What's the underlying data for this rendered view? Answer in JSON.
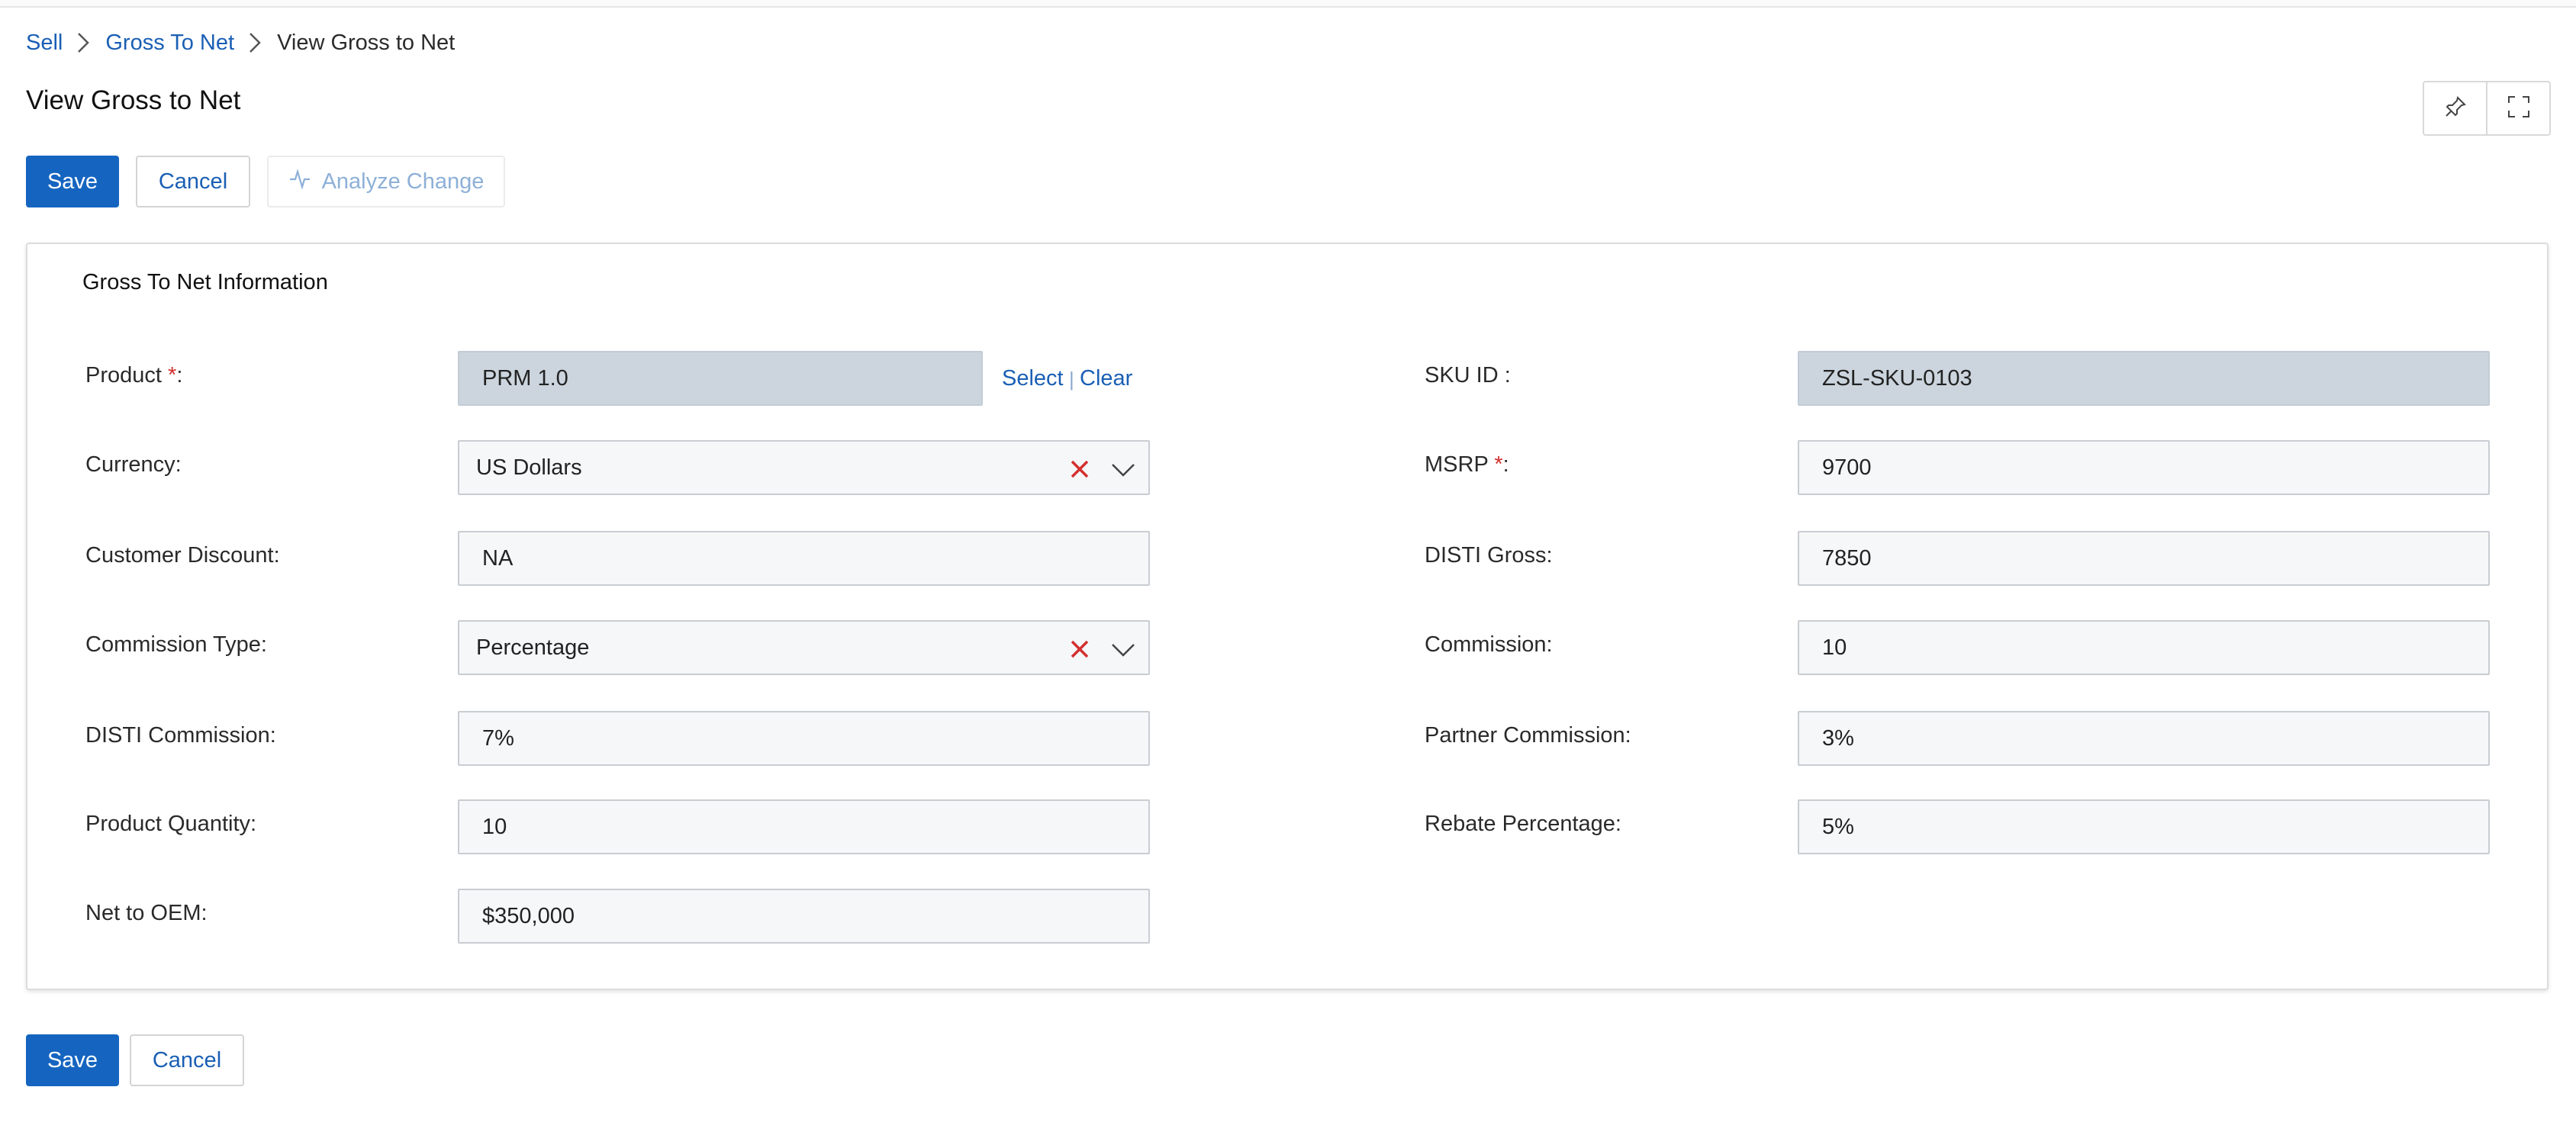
{
  "breadcrumb": {
    "items": [
      "Sell",
      "Gross To Net"
    ],
    "current": "View Gross to Net"
  },
  "page": {
    "title": "View Gross to Net"
  },
  "toolbar": {
    "save_label": "Save",
    "cancel_label": "Cancel",
    "analyze_label": "Analyze Change"
  },
  "section": {
    "title": "Gross To Net Information"
  },
  "left_fields": {
    "product": {
      "label": "Product",
      "required_mark": "*",
      "colon": ":",
      "value": "PRM 1.0",
      "select_label": "Select",
      "separator": "|",
      "clear_label": "Clear"
    },
    "currency": {
      "label": "Currency:",
      "value": "US Dollars"
    },
    "customer_discount": {
      "label": "Customer Discount:",
      "value": "NA"
    },
    "commission_type": {
      "label": "Commission Type:",
      "value": "Percentage"
    },
    "disti_commission": {
      "label": "DISTI Commission:",
      "value": "7%"
    },
    "product_quantity": {
      "label": "Product Quantity:",
      "value": "10"
    },
    "net_to_oem": {
      "label": "Net to OEM:",
      "value": "$350,000"
    }
  },
  "right_fields": {
    "sku_id": {
      "label": "SKU ID :",
      "value": "ZSL-SKU-0103"
    },
    "msrp": {
      "label": "MSRP",
      "required_mark": "*",
      "colon": ":",
      "value": "9700"
    },
    "disti_gross": {
      "label": "DISTI Gross:",
      "value": "7850"
    },
    "commission": {
      "label": "Commission:",
      "value": "10"
    },
    "partner_commission": {
      "label": "Partner Commission:",
      "value": "3%"
    },
    "rebate_percentage": {
      "label": "Rebate Percentage:",
      "value": "5%"
    }
  },
  "footer": {
    "save_label": "Save",
    "cancel_label": "Cancel"
  },
  "colors": {
    "primary": "#1565c0",
    "link": "#1a5fb4",
    "required": "#d32f2f",
    "clear_x": "#d32f2f",
    "readonly_bg": "#ccd5de"
  },
  "icons": [
    "chevron-right-icon",
    "pin-icon",
    "expand-icon",
    "activity-icon",
    "clear-x-icon",
    "chevron-down-icon"
  ]
}
